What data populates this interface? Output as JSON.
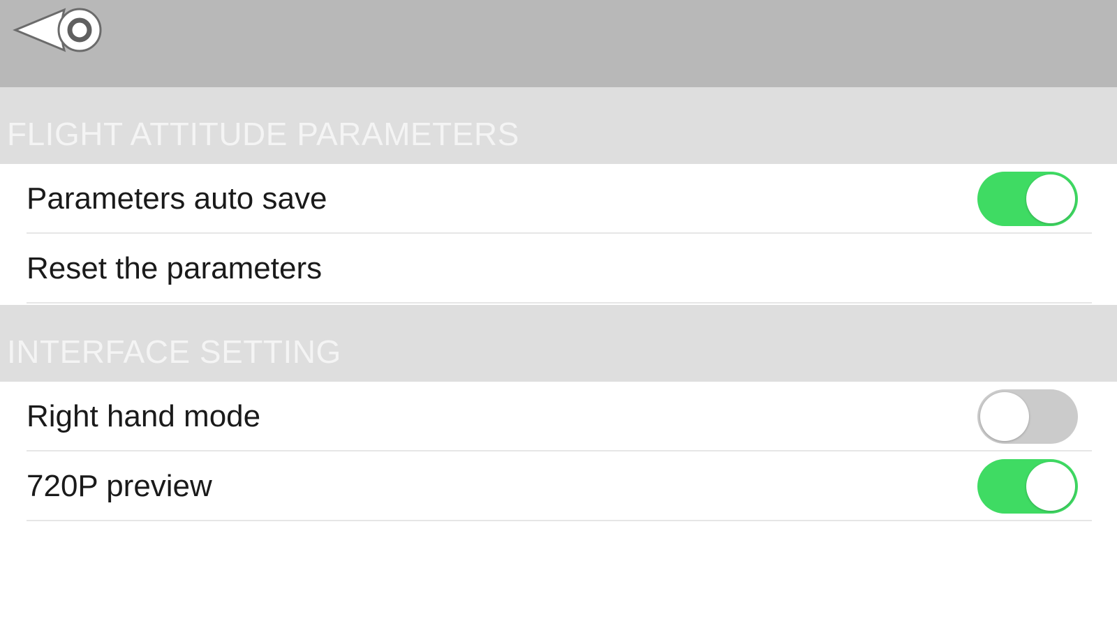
{
  "topbar": {
    "back_icon": "back-arrow-eye-icon"
  },
  "sections": {
    "flight": {
      "title": "FLIGHT ATTITUDE PARAMETERS",
      "items": [
        {
          "label": "Parameters auto save",
          "toggle": true
        },
        {
          "label": "Reset the parameters"
        }
      ]
    },
    "interface": {
      "title": "INTERFACE SETTING",
      "items": [
        {
          "label": "Right hand mode",
          "toggle": false
        },
        {
          "label": "720P preview",
          "toggle": true
        }
      ]
    }
  },
  "colors": {
    "topbar": "#b8b8b8",
    "section_header": "#dedede",
    "toggle_on": "#3fdb63",
    "toggle_off": "#cbcbcb"
  }
}
